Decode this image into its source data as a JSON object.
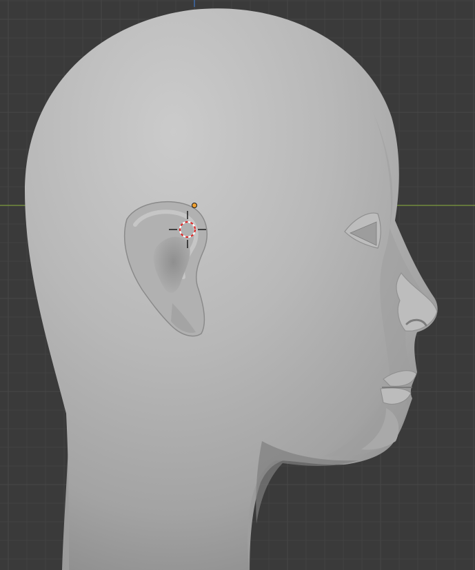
{
  "viewport": {
    "background_color": "#3a3a3a",
    "grid_minor_color": "#424242",
    "grid_major_color": "#484848",
    "x_axis_color": "#7d9c3e",
    "z_axis_color": "#3f6fb4",
    "model_color": "#b9b9b9",
    "origin_color": "#f0a030",
    "cursor_color": "#d82a2a",
    "icons": [
      "3d-cursor-icon",
      "object-origin-icon"
    ]
  }
}
